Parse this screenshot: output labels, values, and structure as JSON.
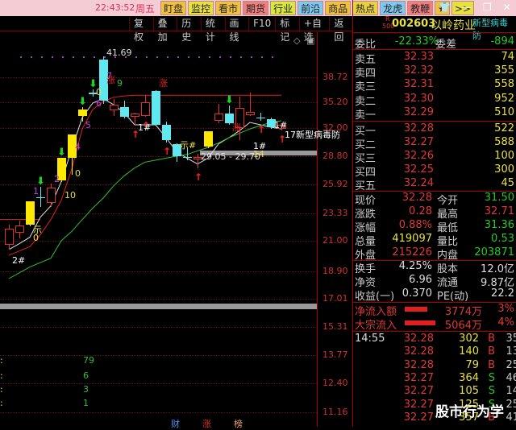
{
  "topbar": {
    "time": "22:43:52",
    "weekday": "周五",
    "buttons": [
      {
        "label": "盯盘",
        "color": "#f0c040"
      },
      {
        "label": "监控",
        "color": "#e8e040"
      },
      {
        "label": "看市",
        "color": "#f0c040"
      },
      {
        "label": "期货",
        "color": "#f08080"
      },
      {
        "label": "行业",
        "color": "#d8e840"
      },
      {
        "label": "前沿",
        "color": "#80c8f0"
      },
      {
        "label": "商品",
        "color": "#f0c040"
      },
      {
        "label": "热点",
        "color": "#e8d040"
      },
      {
        "label": "龙虎",
        "color": "#80c8f0"
      },
      {
        "label": "教鞭",
        "color": "#f08080"
      },
      {
        "label": "★",
        "color": "#f0c040"
      },
      {
        "label": ">>",
        "color": "#e8e040"
      }
    ],
    "window": [
      "👕",
      "—",
      "❐",
      "✕"
    ]
  },
  "menu": [
    "复权",
    "叠加",
    "历史",
    "统计",
    "画线",
    "F10",
    "标记",
    "+自选",
    "返回"
  ],
  "axis": {
    "ticks": [
      "38.72",
      "35.20",
      "32.00",
      "28.80",
      "25.92",
      "23.33",
      "21.00",
      "18.90",
      "17.01",
      "15.31",
      "13.77",
      "12.40",
      "11.16"
    ]
  },
  "candles": [
    {
      "o": 20.7,
      "c": 22.0,
      "h": 22.4,
      "l": 20.4,
      "t": "up"
    },
    {
      "o": 21.7,
      "c": 22.3,
      "h": 22.7,
      "l": 21.2,
      "t": "up"
    },
    {
      "o": 22.4,
      "c": 24.4,
      "h": 24.4,
      "l": 22.2,
      "t": "yellow"
    },
    {
      "o": 24.8,
      "c": 24.8,
      "h": 25.7,
      "l": 23.9,
      "t": "down"
    },
    {
      "o": 24.3,
      "c": 25.6,
      "h": 26.0,
      "l": 23.9,
      "t": "up"
    },
    {
      "o": 26.3,
      "c": 28.6,
      "h": 28.6,
      "l": 26.2,
      "t": "yellow"
    },
    {
      "o": 28.6,
      "c": 31.3,
      "h": 31.3,
      "l": 26.9,
      "t": "yellow"
    },
    {
      "o": 33.5,
      "c": 34.3,
      "h": 34.6,
      "l": 32.8,
      "t": "yellow"
    },
    {
      "o": 36.6,
      "c": 36.3,
      "h": 37.0,
      "l": 36.0,
      "t": "down"
    },
    {
      "o": 41.2,
      "c": 35.4,
      "h": 41.69,
      "l": 35.0,
      "t": "down"
    },
    {
      "o": 34.2,
      "c": 34.9,
      "h": 35.7,
      "l": 33.5,
      "t": "up"
    },
    {
      "o": 34.6,
      "c": 33.4,
      "h": 35.4,
      "l": 33.2,
      "t": "down"
    },
    {
      "o": 33.4,
      "c": 33.8,
      "h": 33.9,
      "l": 32.3,
      "t": "up"
    },
    {
      "o": 33.5,
      "c": 35.2,
      "h": 36.2,
      "l": 33.4,
      "t": "up"
    },
    {
      "o": 36.8,
      "c": 32.4,
      "h": 36.9,
      "l": 32.3,
      "t": "down"
    },
    {
      "o": 32.4,
      "c": 30.6,
      "h": 32.8,
      "l": 30.4,
      "t": "down"
    },
    {
      "o": 30.2,
      "c": 28.8,
      "h": 30.3,
      "l": 28.2,
      "t": "down"
    },
    {
      "o": 28.7,
      "c": 28.7,
      "h": 29.7,
      "l": 28.4,
      "t": "down"
    },
    {
      "o": 28.5,
      "c": 28.7,
      "h": 29.05,
      "l": 27.6,
      "t": "up"
    },
    {
      "o": 29.9,
      "c": 31.6,
      "h": 31.6,
      "l": 29.7,
      "t": "yellow"
    },
    {
      "o": 32.9,
      "c": 33.8,
      "h": 35.0,
      "l": 32.6,
      "t": "up"
    },
    {
      "o": 33.8,
      "c": 32.6,
      "h": 34.8,
      "l": 32.4,
      "t": "down"
    },
    {
      "o": 32.0,
      "c": 34.5,
      "h": 36.0,
      "l": 30.6,
      "t": "up"
    },
    {
      "o": 33.6,
      "c": 34.0,
      "h": 36.6,
      "l": 33.5,
      "t": "up"
    },
    {
      "o": 33.3,
      "c": 33.3,
      "h": 33.9,
      "l": 32.9,
      "t": "down"
    },
    {
      "o": 33.1,
      "c": 32.1,
      "h": 33.3,
      "l": 31.9,
      "t": "down"
    },
    {
      "o": 31.9,
      "c": 32.4,
      "h": 32.5,
      "l": 31.7,
      "t": "up"
    }
  ],
  "lines": [
    {
      "color": "#e0e0e0",
      "values": [
        20.4,
        20.8,
        21.3,
        23.0,
        24.0,
        26.2,
        29.6,
        33.3,
        35.1,
        35.7,
        34.9,
        33.9,
        32.4,
        32.4,
        32.4,
        30.9,
        29.3,
        28.6,
        28.0,
        28.6,
        30.2,
        30.9,
        31.7,
        32.7,
        32.4,
        32.1,
        31.9
      ]
    },
    {
      "color": "#e02020",
      "values": [
        20.0,
        20.3,
        20.6,
        21.5,
        22.8,
        24.5,
        27.5,
        31.9,
        34.3,
        35.3,
        35.9,
        36.1,
        36.2,
        36.2,
        36.2,
        36.2,
        36.2,
        36.2,
        36.2,
        36.2,
        36.2,
        36.2,
        36.2,
        36.2,
        36.2,
        36.2,
        36.2
      ]
    },
    {
      "color": "#30c030",
      "values": [
        18.4,
        18.8,
        19.2,
        19.5,
        19.8,
        21.0,
        21.8,
        22.8,
        23.8,
        24.7,
        25.8,
        26.8,
        27.6,
        28.2,
        28.4,
        28.6,
        28.8,
        29.0,
        29.4,
        29.8,
        30.3,
        30.9,
        31.4,
        31.9,
        32.3,
        32.7,
        32.9
      ]
    }
  ],
  "annotations": [
    {
      "i": 0,
      "p": 19.6,
      "text": "2#",
      "color": "#ffffff"
    },
    {
      "i": 2,
      "p": 22.0,
      "text": "示",
      "color": "#e8e040"
    },
    {
      "i": 2,
      "p": 21.2,
      "text": "0",
      "color": "#e8e040"
    },
    {
      "i": 2,
      "p": 25.3,
      "text": "1",
      "color": "#c040e0"
    },
    {
      "i": 4,
      "p": 26.4,
      "text": "2",
      "color": "#c040e0"
    },
    {
      "i": 5,
      "p": 24.9,
      "text": "10",
      "color": "#e8e040"
    },
    {
      "i": 6,
      "p": 27.0,
      "text": "0",
      "color": "#e8e040"
    },
    {
      "i": 6,
      "p": 29.8,
      "text": "4",
      "color": "#c040e0"
    },
    {
      "i": 7,
      "p": 32.3,
      "text": "5",
      "color": "#c040e0"
    },
    {
      "i": 8,
      "p": 35.0,
      "text": "6",
      "color": "#c040e0"
    },
    {
      "i": 8,
      "p": 36.6,
      "text": "0",
      "color": "#e8e040"
    },
    {
      "i": 9,
      "p": 38.8,
      "text": "7",
      "color": "#c040e0"
    },
    {
      "i": 9,
      "p": 38.5,
      "text": "涨",
      "color": "#e02020"
    },
    {
      "i": 10,
      "p": 37.8,
      "text": "9",
      "color": "#30c030"
    },
    {
      "i": 9,
      "p": 42.1,
      "text": "41.69",
      "color": "#dddddd"
    },
    {
      "i": 12,
      "p": 32.0,
      "text": "1#",
      "color": "#ffffff"
    },
    {
      "i": 14,
      "p": 38.0,
      "text": "涨",
      "color": "#e02020"
    },
    {
      "i": 16,
      "p": 30.2,
      "text": "示#",
      "color": "#e8e040"
    },
    {
      "i": 18,
      "p": 28.7,
      "text": "29.05 - 29.70",
      "color": "#dddddd"
    },
    {
      "i": 21,
      "p": 32.2,
      "text": "涨",
      "color": "#e02020"
    },
    {
      "i": 23,
      "p": 29.9,
      "text": "1#",
      "color": "#ffffff"
    },
    {
      "i": 23,
      "p": 29.0,
      "text": "14",
      "color": "#e8e040"
    },
    {
      "i": 25,
      "p": 32.3,
      "text": "1#",
      "color": "#ffffff"
    },
    {
      "i": 26,
      "p": 31.4,
      "text": "17新型病毒防",
      "color": "#ffffff"
    }
  ],
  "arrows_down": [
    3,
    5,
    7,
    8,
    21
  ],
  "arrows_up": [
    12,
    13,
    15,
    18,
    24,
    26
  ],
  "indicator": {
    "values": [
      "79",
      "6",
      "3",
      "1"
    ]
  },
  "bottom_tags": [
    {
      "text": "财",
      "color": "#5090f0"
    },
    {
      "text": "涨",
      "color": "#e03030"
    },
    {
      "text": "榜",
      "color": "#f0a070"
    }
  ],
  "stock": {
    "market": "R",
    "rank": "500",
    "code": "002603",
    "name": "以岭药业",
    "concept": "新型病毒防"
  },
  "order_ratio": {
    "label1": "委比",
    "value1": "-22.33%",
    "label2": "委差",
    "value2": "-894"
  },
  "asks": [
    {
      "label": "卖五",
      "price": "32.33",
      "vol": "74"
    },
    {
      "label": "卖四",
      "price": "32.32",
      "vol": "355"
    },
    {
      "label": "卖三",
      "price": "32.31",
      "vol": "558"
    },
    {
      "label": "卖二",
      "price": "32.30",
      "vol": "952"
    },
    {
      "label": "卖一",
      "price": "32.29",
      "vol": "510"
    }
  ],
  "bids": [
    {
      "label": "买一",
      "price": "32.28",
      "vol": "522"
    },
    {
      "label": "买二",
      "price": "32.27",
      "vol": "588"
    },
    {
      "label": "买三",
      "price": "32.26",
      "vol": "100"
    },
    {
      "label": "买四",
      "price": "32.25",
      "vol": "300"
    },
    {
      "label": "买五",
      "price": "32.24",
      "vol": "45"
    }
  ],
  "quote": [
    {
      "l1": "现价",
      "v1": "32.28",
      "c1": "red",
      "l2": "今开",
      "v2": "31.50",
      "c2": "grn"
    },
    {
      "l1": "涨跌",
      "v1": "0.28",
      "c1": "red",
      "l2": "最高",
      "v2": "32.71",
      "c2": "red"
    },
    {
      "l1": "涨幅",
      "v1": "0.88%",
      "c1": "red",
      "l2": "最低",
      "v2": "31.36",
      "c2": "grn"
    },
    {
      "l1": "总量",
      "v1": "419097",
      "c1": "yel",
      "l2": "量比",
      "v2": "0.53",
      "c2": "grn"
    },
    {
      "l1": "外盘",
      "v1": "215226",
      "c1": "red",
      "l2": "内盘",
      "v2": "203871",
      "c2": "grn"
    }
  ],
  "fundamentals": [
    {
      "l1": "换手",
      "v1": "4.25%",
      "l2": "股本",
      "v2": "12.0亿"
    },
    {
      "l1": "净资",
      "v1": "6.96",
      "l2": "流通",
      "v2": "9.87亿"
    },
    {
      "l1": "收益(一)",
      "v1": "0.370",
      "l2": "PE(动)",
      "v2": "22.2"
    }
  ],
  "flows": [
    {
      "label": "净流入额",
      "value": "3774万",
      "pct": "3%",
      "bar": 0.47
    },
    {
      "label": "大宗流入",
      "value": "5064万",
      "pct": "4%",
      "bar": 0.63
    }
  ],
  "ticks": [
    {
      "time": "14:55",
      "price": "32.28",
      "vol": "302",
      "side": "B",
      "n": "35"
    },
    {
      "time": "",
      "price": "32.28",
      "vol": "140",
      "side": "B",
      "n": "13"
    },
    {
      "time": "",
      "price": "32.28",
      "vol": "79",
      "side": "B",
      "n": "25"
    },
    {
      "time": "",
      "price": "32.27",
      "vol": "364",
      "side": "S",
      "n": "46"
    },
    {
      "time": "",
      "price": "32.27",
      "vol": "105",
      "side": "S",
      "n": "14"
    },
    {
      "time": "",
      "price": "32.27",
      "vol": "125",
      "side": "S",
      "n": "25"
    },
    {
      "time": "",
      "price": "32.27",
      "vol": "357",
      "side": "B",
      "n": "41"
    }
  ],
  "watermark": "股市行为学"
}
